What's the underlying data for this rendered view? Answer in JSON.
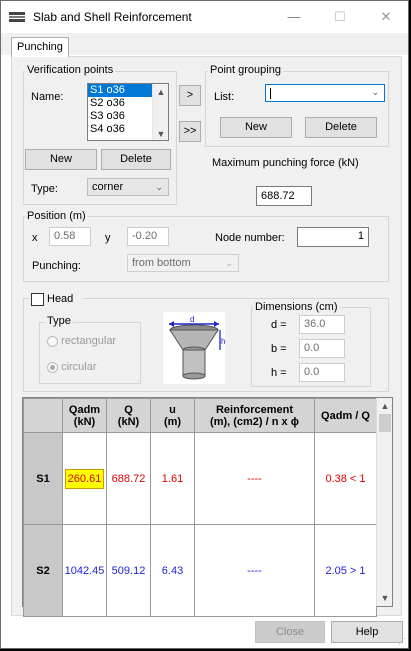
{
  "window": {
    "title": "Slab and Shell Reinforcement",
    "minimize": "—",
    "maximize": "☐",
    "close": "✕",
    "icon": "app-icon"
  },
  "tabs": [
    {
      "label": "Punching",
      "active": true
    }
  ],
  "verification": {
    "legend": "Verification points",
    "name_label": "Name:",
    "items": [
      "S1 o36",
      "S2 o36",
      "S3 o36",
      "S4 o36"
    ],
    "selected_index": 0,
    "new_label": "New",
    "delete_label": "Delete",
    "type_label": "Type:",
    "type_value": "corner"
  },
  "transfer": {
    "one": ">",
    "all": ">>"
  },
  "grouping": {
    "legend": "Point grouping",
    "list_label": "List:",
    "list_value": "",
    "new_label": "New",
    "delete_label": "Delete"
  },
  "max_force": {
    "label": "Maximum punching force (kN)",
    "value": "688.72"
  },
  "position": {
    "legend": "Position (m)",
    "x_label": "x",
    "x_value": "0.58",
    "y_label": "y",
    "y_value": "-0.20",
    "node_label": "Node number:",
    "node_value": "1",
    "punching_label": "Punching:",
    "punching_value": "from bottom"
  },
  "head": {
    "checkbox_label": "Head",
    "checked": false,
    "type_legend": "Type",
    "rect_label": "rectangular",
    "circ_label": "circular",
    "selected": "circular",
    "diagram_d": "d",
    "diagram_h": "h"
  },
  "dimensions": {
    "legend": "Dimensions (cm)",
    "d_label": "d =",
    "d_value": "36.0",
    "b_label": "b =",
    "b_value": "0.0",
    "h_label": "h =",
    "h_value": "0.0"
  },
  "table": {
    "headers": [
      "",
      "Qadm\n(kN)",
      "Q\n(kN)",
      "u\n(m)",
      "Reinforcement\n(m), (cm2) / n x ϕ",
      "Qadm / Q"
    ],
    "rows": [
      {
        "name": "S1",
        "qadm": "260.61",
        "q": "688.72",
        "u": "1.61",
        "reinf": "----",
        "ratio": "0.38 < 1",
        "status_color": "#e00000",
        "qadm_highlight": true
      },
      {
        "name": "S2",
        "qadm": "1042.45",
        "q": "509.12",
        "u": "6.43",
        "reinf": "----",
        "ratio": "2.05 > 1",
        "status_color": "#1f1fe0",
        "qadm_highlight": false
      }
    ]
  },
  "footer": {
    "close_label": "Close",
    "help_label": "Help"
  }
}
